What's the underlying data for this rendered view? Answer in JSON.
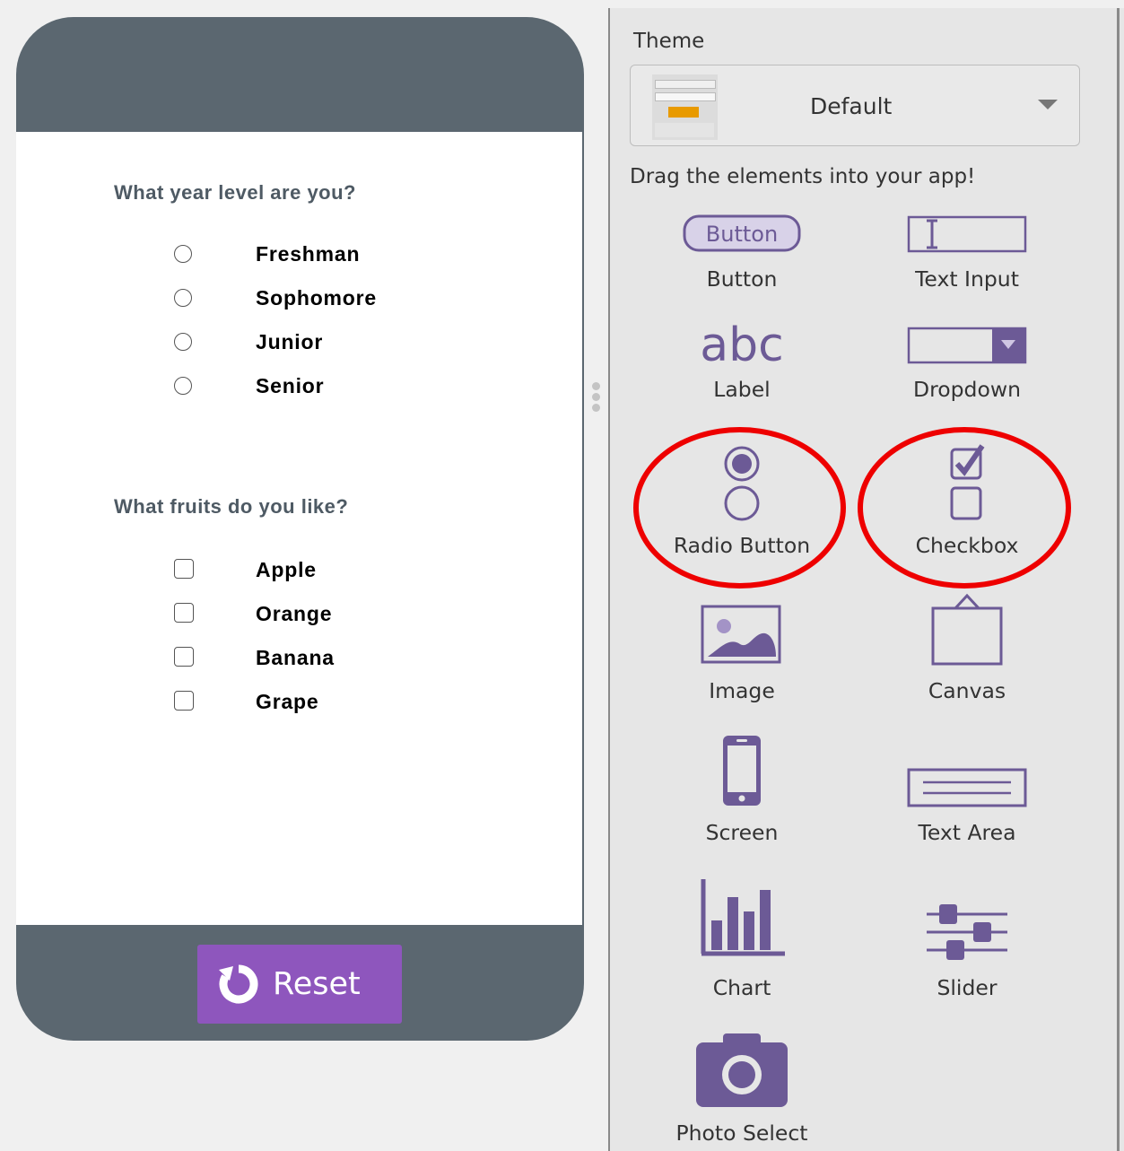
{
  "colors": {
    "accent": "#6c5a96",
    "reset_button": "#8e56bd",
    "phone_frame": "#5b6770",
    "highlight": "#ee0000"
  },
  "app": {
    "question1": {
      "label": "What year level are you?",
      "options": [
        "Freshman",
        "Sophomore",
        "Junior",
        "Senior"
      ],
      "control": "radio"
    },
    "question2": {
      "label": "What fruits do you like?",
      "options": [
        "Apple",
        "Orange",
        "Banana",
        "Grape"
      ],
      "control": "checkbox"
    },
    "reset_button": {
      "label": "Reset",
      "icon": "refresh-icon"
    }
  },
  "toolbox": {
    "theme_title": "Theme",
    "theme_value": "Default",
    "drag_hint": "Drag the elements into your app!",
    "button_icon_text": "Button",
    "label_icon_text": "abc",
    "items": [
      {
        "label": "Button",
        "icon": "button-icon"
      },
      {
        "label": "Text Input",
        "icon": "text-input-icon"
      },
      {
        "label": "Label",
        "icon": "label-icon"
      },
      {
        "label": "Dropdown",
        "icon": "dropdown-icon"
      },
      {
        "label": "Radio Button",
        "icon": "radio-button-icon",
        "highlighted": true
      },
      {
        "label": "Checkbox",
        "icon": "checkbox-icon",
        "highlighted": true
      },
      {
        "label": "Image",
        "icon": "image-icon"
      },
      {
        "label": "Canvas",
        "icon": "canvas-icon"
      },
      {
        "label": "Screen",
        "icon": "screen-icon"
      },
      {
        "label": "Text Area",
        "icon": "text-area-icon"
      },
      {
        "label": "Chart",
        "icon": "chart-icon"
      },
      {
        "label": "Slider",
        "icon": "slider-icon"
      },
      {
        "label": "Photo Select",
        "icon": "camera-icon"
      }
    ]
  }
}
